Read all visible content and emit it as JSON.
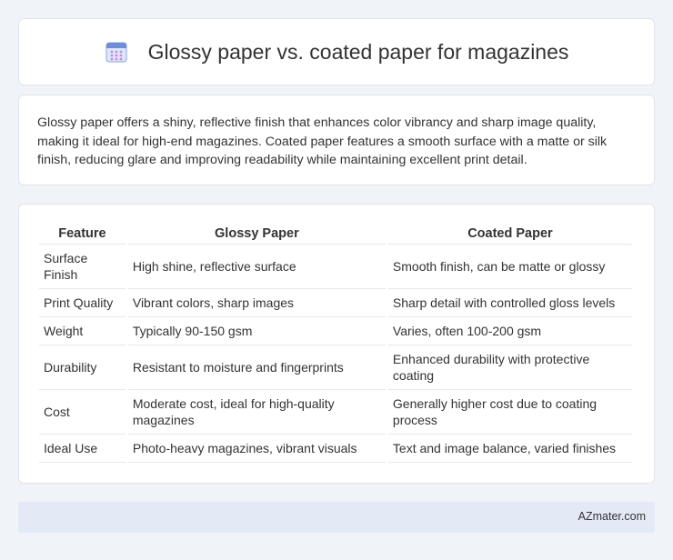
{
  "header": {
    "title": "Glossy paper vs. coated paper for magazines",
    "icon": "calendar-icon",
    "icon_color": "#5b7fd6"
  },
  "intro": {
    "text": "Glossy paper offers a shiny, reflective finish that enhances color vibrancy and sharp image quality, making it ideal for high-end magazines. Coated paper features a smooth surface with a matte or silk finish, reducing glare and improving readability while maintaining excellent print detail."
  },
  "table": {
    "headers": [
      "Feature",
      "Glossy Paper",
      "Coated Paper"
    ],
    "rows": [
      [
        "Surface Finish",
        "High shine, reflective surface",
        "Smooth finish, can be matte or glossy"
      ],
      [
        "Print Quality",
        "Vibrant colors, sharp images",
        "Sharp detail with controlled gloss levels"
      ],
      [
        "Weight",
        "Typically 90-150 gsm",
        "Varies, often 100-200 gsm"
      ],
      [
        "Durability",
        "Resistant to moisture and fingerprints",
        "Enhanced durability with protective coating"
      ],
      [
        "Cost",
        "Moderate cost, ideal for high-quality magazines",
        "Generally higher cost due to coating process"
      ],
      [
        "Ideal Use",
        "Photo-heavy magazines, vibrant visuals",
        "Text and image balance, varied finishes"
      ]
    ]
  },
  "footer": {
    "brand": "AZmater.com"
  }
}
